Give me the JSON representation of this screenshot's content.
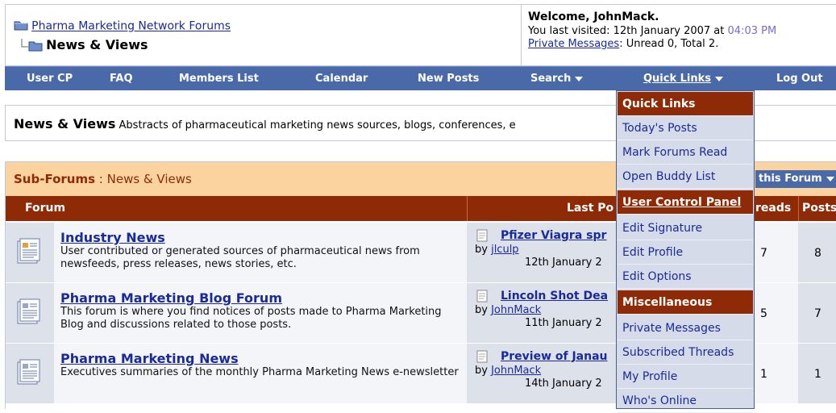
{
  "header": {
    "site_link": "Pharma Marketing Network Forums",
    "current_forum": "News & Views",
    "welcome": "Welcome, JohnMack.",
    "last_visited_prefix": "You last visited: 12th January 2007 at ",
    "last_visited_time": "04:03 PM",
    "pm_link": "Private Messages",
    "pm_status": ": Unread 0, Total 2."
  },
  "nav": {
    "items": [
      "User CP",
      "FAQ",
      "Members List",
      "Calendar",
      "New Posts",
      "Search",
      "Quick Links",
      "Log Out"
    ]
  },
  "description": {
    "title": "News & Views",
    "text": "Abstracts of pharmaceutical marketing news sources, blogs, conferences, e"
  },
  "subforums": {
    "label": "Sub-Forums",
    "separator": " : ",
    "name": "News & Views",
    "forum_tools": "this Forum",
    "columns": {
      "forum": "Forum",
      "last_post": "Last Po",
      "threads": "reads",
      "posts": "Posts"
    },
    "rows": [
      {
        "title": "Industry News",
        "desc": "User contributed or generated sources of pharmaceutical news from newsfeeds, press releases, news stories, etc.",
        "last_title": "Pfizer Viagra spr",
        "by": "by ",
        "user": "jlculp",
        "date": "12th January 2",
        "threads": "7",
        "posts": "8"
      },
      {
        "title": "Pharma Marketing Blog Forum",
        "desc": "This forum is where you find notices of posts made to Pharma Marketing Blog and discussions related to those posts.",
        "last_title": "Lincoln Shot Dea",
        "by": "by ",
        "user": "JohnMack",
        "date": "11th January 2",
        "threads": "5",
        "posts": "7"
      },
      {
        "title": "Pharma Marketing News",
        "desc": "Executives summaries of the monthly Pharma Marketing News e-newsletter",
        "last_title": "Preview of Janau",
        "by": "by ",
        "user": "JohnMack",
        "date": "14th January 2",
        "threads": "1",
        "posts": "1"
      }
    ]
  },
  "quick_links_menu": {
    "items": [
      {
        "label": "Quick Links",
        "header": true
      },
      {
        "label": "Today's Posts"
      },
      {
        "label": "Mark Forums Read"
      },
      {
        "label": "Open Buddy List"
      },
      {
        "label": "User Control Panel",
        "header": true
      },
      {
        "label": "Edit Signature"
      },
      {
        "label": "Edit Profile"
      },
      {
        "label": "Edit Options"
      },
      {
        "label": "Miscellaneous",
        "header": true
      },
      {
        "label": "Private Messages"
      },
      {
        "label": "Subscribed Threads"
      },
      {
        "label": "My Profile"
      },
      {
        "label": "Who's Online"
      }
    ]
  },
  "colors": {
    "nav_bar": "#4a69a8",
    "menu_header": "#8f2a07",
    "subforum_header": "#fbd39e",
    "link": "#1a2a9a"
  }
}
